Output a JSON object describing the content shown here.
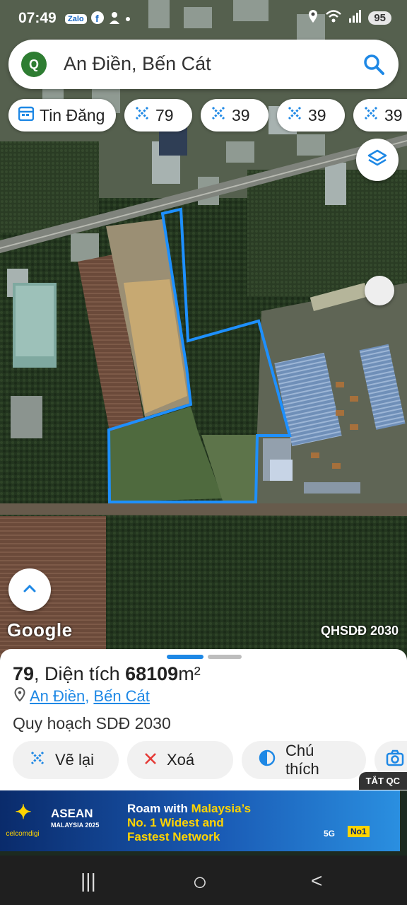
{
  "status_bar": {
    "time": "07:49",
    "app_icons": [
      "Zalo",
      "facebook-icon",
      "person-icon",
      "dot-icon"
    ],
    "battery": "95"
  },
  "search": {
    "logo_letter": "Q",
    "query": "An Điền, Bến Cát"
  },
  "chips": [
    {
      "icon": "calendar-icon",
      "label": "Tin Đăng"
    },
    {
      "icon": "polygon-draw-icon",
      "label": "79"
    },
    {
      "icon": "polygon-draw-icon",
      "label": "39"
    },
    {
      "icon": "polygon-draw-icon",
      "label": "39"
    },
    {
      "icon": "polygon-draw-icon",
      "label": "39"
    }
  ],
  "map": {
    "attribution": "Google",
    "overlay_label": "QHSDĐ 2030",
    "accent_color": "#1e90ff"
  },
  "panel": {
    "parcel_number": "79",
    "area_prefix": ", Diện tích ",
    "area_value": "68109",
    "area_unit": "m²",
    "ward": "An Điền",
    "separator": ",",
    "district": "Bến Cát",
    "plan": "Quy hoạch SDĐ 2030",
    "actions": [
      {
        "icon": "polygon-draw-icon",
        "label": "Vẽ lại"
      },
      {
        "icon": "close-icon",
        "label": "Xoá"
      },
      {
        "icon": "half-circle-icon",
        "label": "Chú thích"
      },
      {
        "icon": "camera-icon",
        "label": ""
      }
    ]
  },
  "ad": {
    "close_label": "TẮT QC",
    "brand": "celcomdigi",
    "event": "ASEAN",
    "event_sub": "MALAYSIA 2025",
    "line1_a": "Roam with ",
    "line1_b": "Malaysia’s",
    "line2": "No. 1 Widest and",
    "line3": "Fastest Network",
    "badge_5g": "5G",
    "badge_no1": "No1"
  },
  "nav": {
    "recents": "|||",
    "home": "○",
    "back": "<"
  }
}
